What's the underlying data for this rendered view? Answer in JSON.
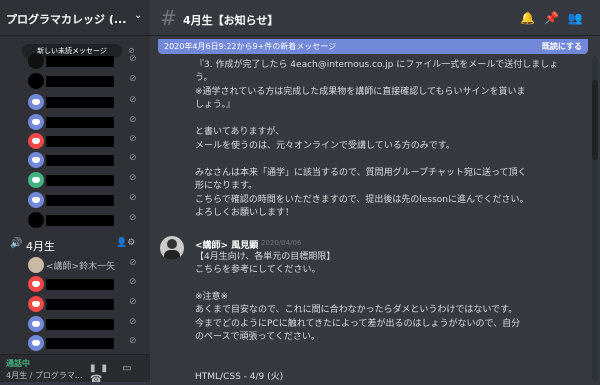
{
  "guild": {
    "name": "プログラマカレッジ (...",
    "unread_pill": "新しい未読メッセージ"
  },
  "channel": {
    "name": "4月生【お知らせ】"
  },
  "voice_channel": {
    "name": "4月生",
    "teacher": "<講師>鈴木一矢"
  },
  "voice_panel": {
    "status": "通話中",
    "sub": "4月生 / プログラマ..."
  },
  "banner": {
    "text": "2020年4月6日9:22から9+件の新着メッセージ",
    "action": "既読にする"
  },
  "message1": {
    "lines": [
      "『3. 作成が完了したら 4each@internous.co.jp にファイル一式をメールで送付しましょ",
      "う。",
      "※通学されている方は完成した成果物を講師に直接確認してもらいサインを貰いま",
      "しょう。』",
      "",
      "と書いてありますが、",
      "メールを使うのは、元々オンラインで受講している方のみです。",
      "",
      "みなさんは本来「通学」に該当するので、質問用グループチャット宛に送って頂く",
      "形になります。",
      "こちらで確認の時間をいただきますので、提出後は先のlessonに進んでください。",
      "よろしくお願いします！"
    ]
  },
  "message2": {
    "author": "<講師> 風見顕",
    "timestamp": "2020/04/06",
    "lines": [
      "【4月生向け、各単元の目標期限】",
      "こちらを参考にしてください。",
      "",
      "※注意※",
      "あくまで目安なので、これに間に合わなかったらダメというわけではないです。",
      "今までどのようにPCに触れてきたによって差が出るのはしょうがないので、自分",
      "のペースで頑張ってください。",
      "",
      "HTML/CSS - 4/9 (火)"
    ]
  },
  "colors": {
    "accent": "#7289da",
    "online": "#43b581",
    "bg": "#36393f",
    "sidebar": "#2f3136"
  }
}
